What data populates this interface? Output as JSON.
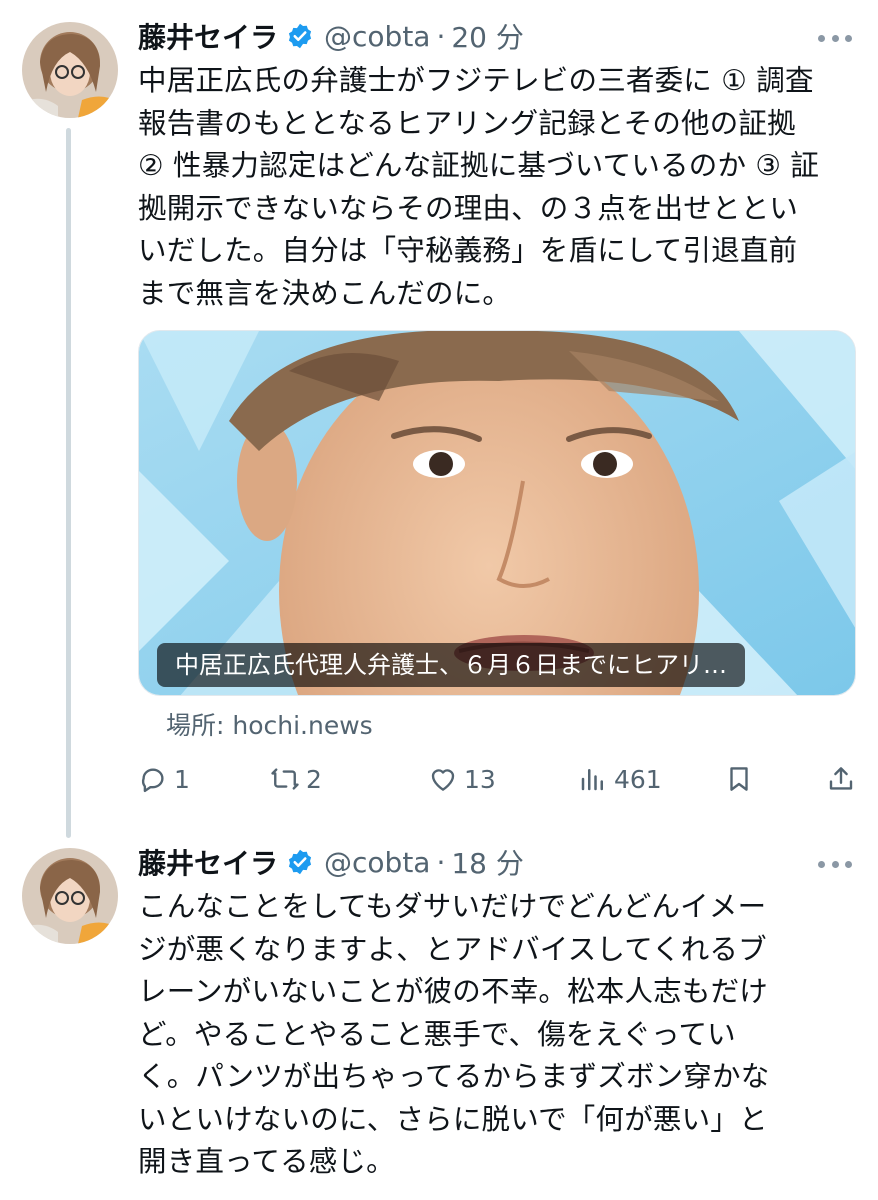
{
  "tweets": [
    {
      "display_name": "藤井セイラ",
      "handle": "@cobta",
      "separator": "·",
      "time": "20 分",
      "text": "中居正広氏の弁護士がフジテレビの三者委に ① 調査\n報告書のもととなるヒアリング記録とその他の証拠\n② 性暴力認定はどんな証拠に基づいているのか ③ 証\n拠開示できないならその理由、の３点を出せととい\nいだした。自分は「守秘義務」を盾にして引退直前\nまで無言を決めこんだのに。",
      "card": {
        "caption": "中居正広氏代理人弁護士、６月６日までにヒアリ…",
        "source": "場所: hochi.news"
      },
      "actions": {
        "reply_icon": "reply-icon",
        "reply_count": "1",
        "retweet_icon": "retweet-icon",
        "retweet_count": "2",
        "like_icon": "heart-icon",
        "like_count": "13",
        "views_icon": "views-icon",
        "view_count": "461",
        "bookmark_icon": "bookmark-icon",
        "share_icon": "share-icon"
      }
    },
    {
      "display_name": "藤井セイラ",
      "handle": "@cobta",
      "separator": "·",
      "time": "18 分",
      "text": "こんなことをしてもダサいだけでどんどんイメー\nジが悪くなりますよ、とアドバイスしてくれるブ\nレーンがいないことが彼の不幸。松本人志もだけ\nど。やることやること悪手で、傷をえぐってい\nく。パンツが出ちゃってるからまずズボン穿かな\nいといけないのに、さらに脱いで「何が悪い」と\n開き直ってる感じ。"
    }
  ],
  "colors": {
    "text": "#0f1419",
    "secondary": "#536471",
    "verified": "#1d9bf0",
    "thread_line": "#cfd9de"
  }
}
